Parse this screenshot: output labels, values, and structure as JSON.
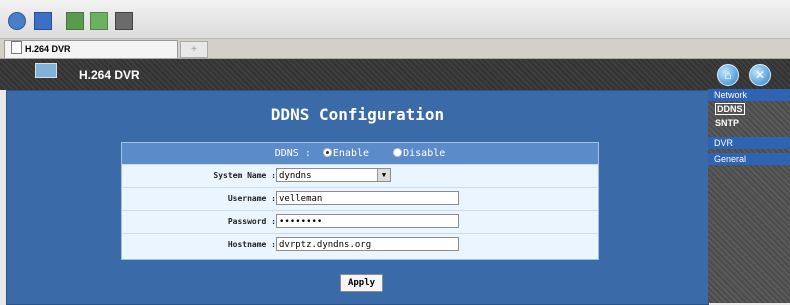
{
  "browser": {
    "toolbar_icons": [
      "history-icon",
      "favorites-icon",
      "add-favorite-icon",
      "add-page-icon",
      "print-icon"
    ],
    "tab": {
      "title": "H.264 DVR",
      "new_tab_glyph": "+"
    }
  },
  "header": {
    "title": "H.264 DVR",
    "icons": [
      "home-icon",
      "tools-icon"
    ]
  },
  "page": {
    "title": "DDNS Configuration",
    "ddns": {
      "label": "DDNS :",
      "enable_label": "Enable",
      "disable_label": "Disable",
      "selected": "Enable"
    },
    "fields": [
      {
        "label": "System Name :",
        "value": "dyndns",
        "type": "select"
      },
      {
        "label": "Username :",
        "value": "velleman",
        "type": "text"
      },
      {
        "label": "Password :",
        "value": "••••••••",
        "type": "password"
      },
      {
        "label": "Hostname :",
        "value": "dvrptz.dyndns.org",
        "type": "text"
      }
    ],
    "apply_label": "Apply"
  },
  "sidebar": {
    "network": {
      "header": "Network",
      "items": [
        "DDNS",
        "SNTP"
      ],
      "selected": "DDNS"
    },
    "dvr": {
      "header": "DVR"
    },
    "general": {
      "header": "General"
    }
  }
}
